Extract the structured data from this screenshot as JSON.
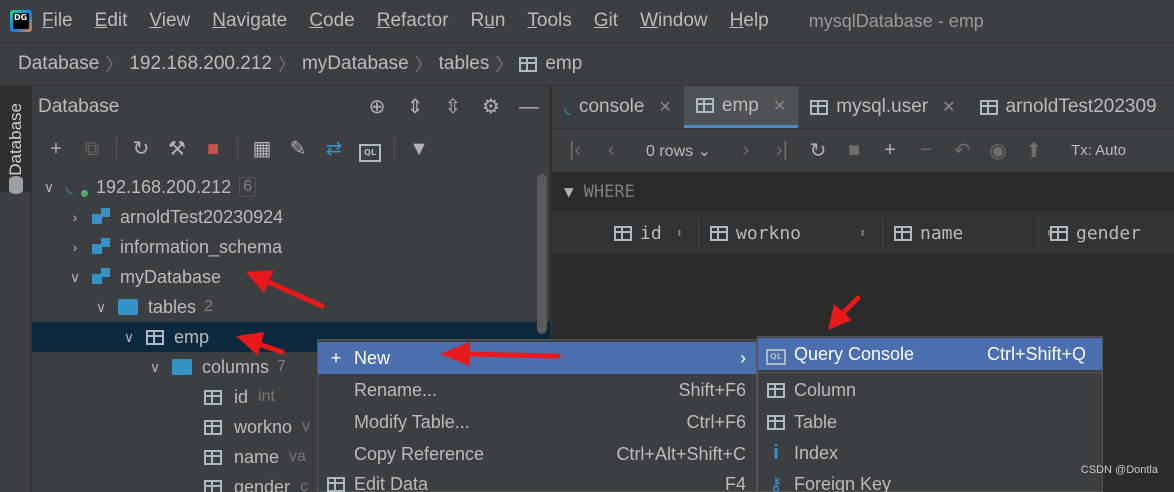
{
  "menubar": {
    "logo_text": "DG",
    "items": [
      "File",
      "Edit",
      "View",
      "Navigate",
      "Code",
      "Refactor",
      "Run",
      "Tools",
      "Git",
      "Window",
      "Help"
    ],
    "mnemonics": [
      "F",
      "E",
      "V",
      "N",
      "C",
      "R",
      "u",
      "T",
      "G",
      "W",
      "H"
    ],
    "window_title": "mysqlDatabase - emp"
  },
  "breadcrumbs": [
    "Database",
    "192.168.200.212",
    "myDatabase",
    "tables",
    "emp"
  ],
  "left_strip": {
    "tab_label": "Database"
  },
  "db_panel": {
    "title": "Database",
    "tree": [
      {
        "label": "192.168.200.212",
        "count": "6",
        "type": "host"
      },
      {
        "label": "arnoldTest20230924",
        "type": "schema"
      },
      {
        "label": "information_schema",
        "type": "schema"
      },
      {
        "label": "myDatabase",
        "type": "schema"
      },
      {
        "label": "tables",
        "count": "2",
        "type": "folder"
      },
      {
        "label": "emp",
        "type": "table"
      },
      {
        "label": "columns",
        "count": "7",
        "type": "folder"
      },
      {
        "label": "id",
        "coltype": "int",
        "type": "column"
      },
      {
        "label": "workno",
        "coltype": "v",
        "type": "column"
      },
      {
        "label": "name",
        "coltype": "va",
        "type": "column"
      },
      {
        "label": "gender",
        "coltype": "c",
        "type": "column"
      }
    ]
  },
  "editor": {
    "tabs": [
      {
        "label": "console",
        "active": false
      },
      {
        "label": "emp",
        "active": true
      },
      {
        "label": "mysql.user",
        "active": false
      },
      {
        "label": "arnoldTest202309",
        "active": false
      }
    ],
    "rows_label": "0 rows",
    "tx_label": "Tx: Auto",
    "where_label": "WHERE",
    "columns": [
      "id",
      "workno",
      "name",
      "gender"
    ]
  },
  "context_menu": {
    "items": [
      {
        "label": "New",
        "shortcut": "",
        "highlighted": true
      },
      {
        "label": "Rename...",
        "shortcut": "Shift+F6"
      },
      {
        "label": "Modify Table...",
        "shortcut": "Ctrl+F6"
      },
      {
        "label": "Copy Reference",
        "shortcut": "Ctrl+Alt+Shift+C"
      },
      {
        "label": "Edit Data",
        "shortcut": "F4"
      }
    ]
  },
  "submenu": {
    "items": [
      {
        "label": "Query Console",
        "shortcut": "Ctrl+Shift+Q",
        "highlighted": true,
        "icon": "query-console-icon"
      },
      {
        "label": "Column",
        "shortcut": "",
        "icon": "column-icon"
      },
      {
        "label": "Table",
        "shortcut": "",
        "icon": "table-icon"
      },
      {
        "label": "Index",
        "shortcut": "",
        "icon": "index-icon"
      },
      {
        "label": "Foreign Key",
        "shortcut": "",
        "icon": "foreign-key-icon"
      }
    ]
  },
  "watermark": "CSDN @Dontla",
  "colors": {
    "annotation_arrow": "#e8191b",
    "selection_highlight": "#4b6eaf",
    "tree_selected": "#0d293e",
    "accent_blue": "#3592c4"
  }
}
